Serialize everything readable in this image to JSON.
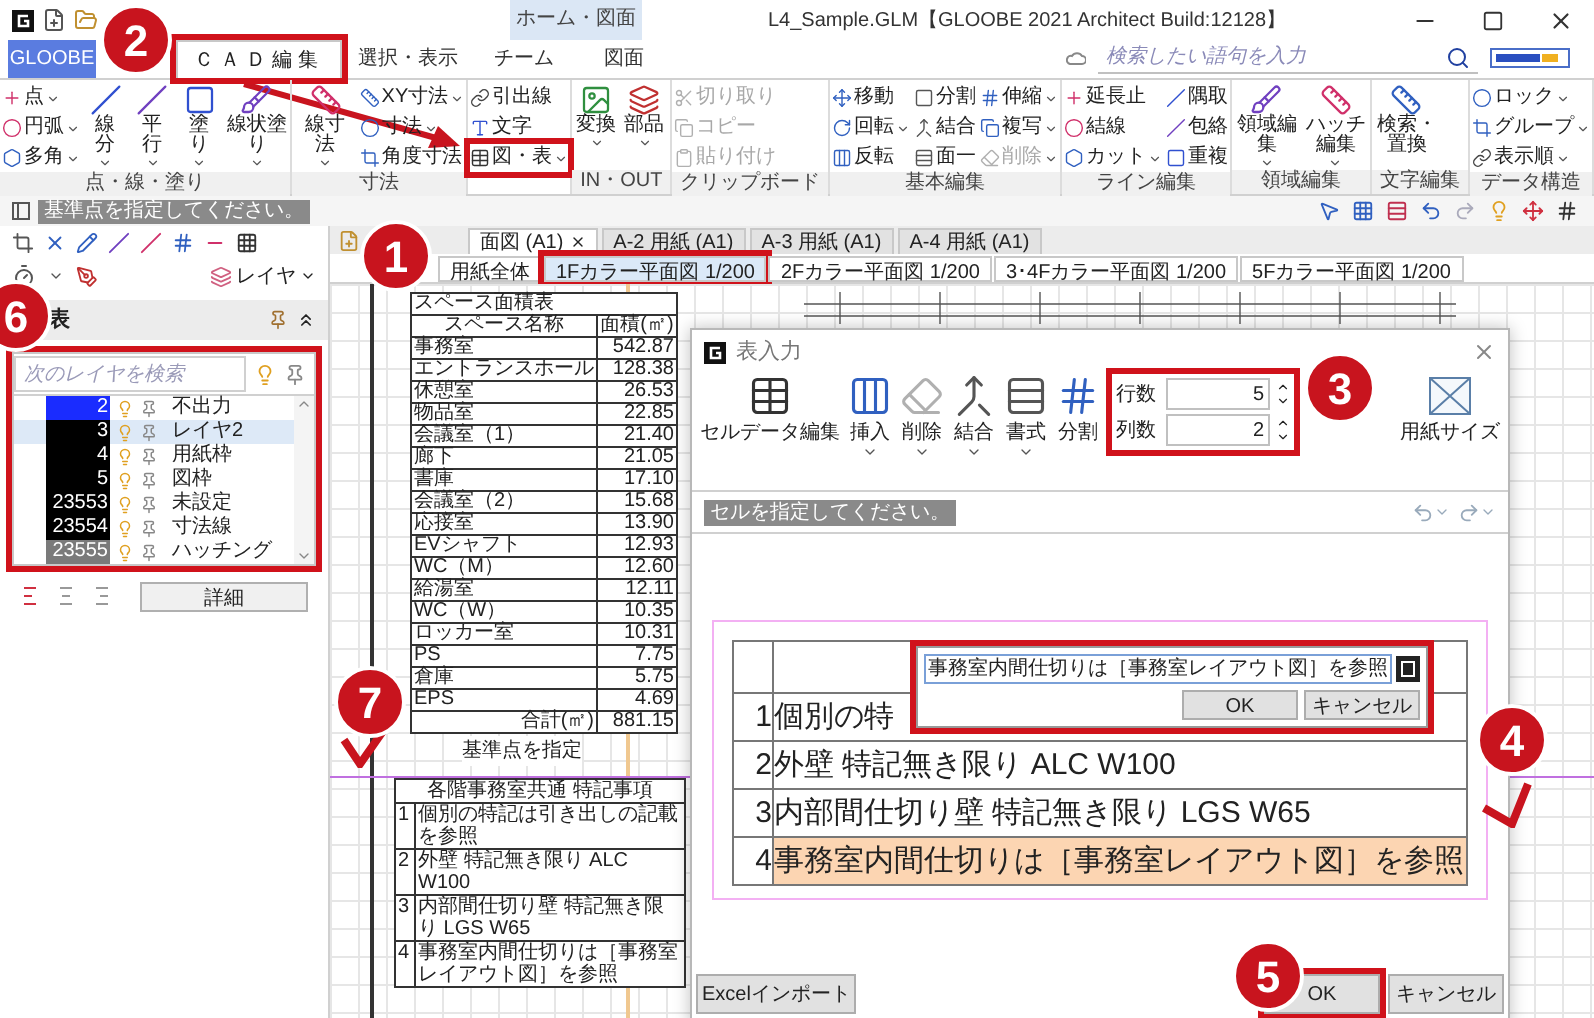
{
  "title_bar": {
    "title": "L4_Sample.GLM【GLOOBE 2021 Architect Build:12128】",
    "context_label": "ホーム・図面"
  },
  "ribbon": {
    "tabs": [
      {
        "label": "GLOOBE",
        "kind": "app",
        "selected": false,
        "highlighted": false
      },
      {
        "label": "ＣＡＤ編集",
        "kind": "tab",
        "selected": true,
        "highlighted": true
      },
      {
        "label": "選択・表示",
        "kind": "tab",
        "selected": false,
        "highlighted": false
      },
      {
        "label": "チーム",
        "kind": "tab",
        "selected": false,
        "highlighted": false
      },
      {
        "label": "図面",
        "kind": "tab",
        "selected": false,
        "highlighted": false
      }
    ],
    "search": {
      "placeholder": "検索したい語句を入力"
    },
    "groups": [
      {
        "label": "点・線・塗り",
        "items": [
          {
            "kind": "small",
            "label": "点",
            "dropdown": true
          },
          {
            "kind": "small",
            "label": "円弧",
            "dropdown": true
          },
          {
            "kind": "small",
            "label": "多角",
            "dropdown": true
          },
          {
            "kind": "large",
            "label": "線分",
            "dropdown": true
          },
          {
            "kind": "large",
            "label": "平行",
            "dropdown": true
          },
          {
            "kind": "large",
            "label": "塗り",
            "dropdown": true
          },
          {
            "kind": "large",
            "label": "線状塗り",
            "dropdown": true
          }
        ]
      },
      {
        "label": "寸法",
        "items": [
          {
            "kind": "large",
            "label": "線寸法",
            "dropdown": true
          },
          {
            "kind": "small",
            "label": "XY寸法",
            "dropdown": true
          },
          {
            "kind": "small",
            "label": "寸法",
            "dropdown": true
          },
          {
            "kind": "small",
            "label": "角度寸法",
            "dropdown": false
          }
        ]
      },
      {
        "items": [
          {
            "kind": "small",
            "label": "引出線",
            "dropdown": false,
            "highlighted": false
          },
          {
            "kind": "small",
            "label": "文字",
            "dropdown": false,
            "highlighted": false
          },
          {
            "kind": "small",
            "label": "図・表",
            "dropdown": true,
            "highlighted": true
          }
        ]
      },
      {
        "label": "IN・OUT",
        "items": [
          {
            "kind": "large",
            "label": "変換",
            "dropdown": true
          },
          {
            "kind": "large",
            "label": "部品",
            "dropdown": true
          }
        ]
      },
      {
        "label": "クリップボード",
        "items": [
          {
            "kind": "small",
            "label": "切り取り",
            "dropdown": false,
            "disabled": true
          },
          {
            "kind": "small",
            "label": "コピー",
            "dropdown": false,
            "disabled": true
          },
          {
            "kind": "small",
            "label": "貼り付け",
            "dropdown": false,
            "disabled": true
          }
        ]
      },
      {
        "label": "基本編集",
        "items": [
          {
            "kind": "small",
            "label": "移動",
            "dropdown": false,
            "disabled": false
          },
          {
            "kind": "small",
            "label": "回転",
            "dropdown": true,
            "disabled": false
          },
          {
            "kind": "small",
            "label": "反転",
            "dropdown": false,
            "disabled": false
          },
          {
            "kind": "small",
            "label": "分割",
            "dropdown": false,
            "disabled": false
          },
          {
            "kind": "small",
            "label": "結合",
            "dropdown": false,
            "disabled": false
          },
          {
            "kind": "small",
            "label": "面一",
            "dropdown": false,
            "disabled": false
          },
          {
            "kind": "small",
            "label": "伸縮",
            "dropdown": true,
            "disabled": false
          },
          {
            "kind": "small",
            "label": "複写",
            "dropdown": true,
            "disabled": false
          },
          {
            "kind": "small",
            "label": "削除",
            "dropdown": true,
            "disabled": true
          }
        ]
      },
      {
        "label": "ライン編集",
        "items": [
          {
            "kind": "small",
            "label": "延長止",
            "dropdown": false
          },
          {
            "kind": "small",
            "label": "結線",
            "dropdown": false
          },
          {
            "kind": "small",
            "label": "カット",
            "dropdown": true
          },
          {
            "kind": "small",
            "label": "隅取",
            "dropdown": false
          },
          {
            "kind": "small",
            "label": "包絡",
            "dropdown": false
          },
          {
            "kind": "small",
            "label": "重複",
            "dropdown": false
          }
        ]
      },
      {
        "label": "領域編集",
        "items": [
          {
            "kind": "large",
            "label": "領域編集",
            "dropdown": true
          },
          {
            "kind": "large",
            "label": "ハッチ編集",
            "dropdown": true
          }
        ]
      },
      {
        "label": "文字編集",
        "items": [
          {
            "kind": "large",
            "label": "検索・置換",
            "dropdown": false
          }
        ]
      },
      {
        "label": "データ構造",
        "items": [
          {
            "kind": "small",
            "label": "ロック",
            "dropdown": true
          },
          {
            "kind": "small",
            "label": "グループ",
            "dropdown": true
          },
          {
            "kind": "small",
            "label": "表示順",
            "dropdown": true
          }
        ]
      }
    ]
  },
  "status": "基準点を指定してください。",
  "left_panel": {
    "layer_button": "レイヤ",
    "title": "表",
    "highlighted": true,
    "search": {
      "placeholder": "次のレイヤを検索"
    },
    "layers": [
      {
        "number": "2",
        "name": "不出力",
        "color": "#1a2cff",
        "selected": false
      },
      {
        "number": "3",
        "name": "レイヤ2",
        "color": "#000000",
        "selected": true
      },
      {
        "number": "4",
        "name": "用紙枠",
        "color": "#000000",
        "selected": false
      },
      {
        "number": "5",
        "name": "図枠",
        "color": "#000000",
        "selected": false
      },
      {
        "number": "23553",
        "name": "未設定",
        "color": "#000000",
        "selected": false
      },
      {
        "number": "23554",
        "name": "寸法線",
        "color": "#000000",
        "selected": false
      },
      {
        "number": "23555",
        "name": "ハッチング",
        "color": "#7a7a7a",
        "selected": false
      }
    ],
    "detail_button": "詳細"
  },
  "doc_tabs": [
    {
      "label": "面図 (A1)",
      "selected": true,
      "closable": true
    },
    {
      "label": "A-2 用紙 (A1)",
      "selected": false,
      "closable": false
    },
    {
      "label": "A-3 用紙 (A1)",
      "selected": false,
      "closable": false
    },
    {
      "label": "A-4 用紙 (A1)",
      "selected": false,
      "closable": false
    }
  ],
  "view_tabs": [
    {
      "label": "用紙全体",
      "selected": false,
      "highlighted": false
    },
    {
      "label": "1Fカラー平面図 1/200",
      "selected": true,
      "highlighted": true
    },
    {
      "label": "2Fカラー平面図 1/200",
      "selected": false,
      "highlighted": false
    },
    {
      "label": "3･4Fカラー平面図 1/200",
      "selected": false,
      "highlighted": false
    },
    {
      "label": "5Fカラー平面図 1/200",
      "selected": false,
      "highlighted": false
    }
  ],
  "canvas": {
    "area_table": {
      "title": "スペース面積表",
      "columns": [
        "スペース名称",
        "面積(㎡)"
      ],
      "rows": [
        {
          "name": "事務室",
          "area": "542.87"
        },
        {
          "name": "エントランスホール",
          "area": "128.38"
        },
        {
          "name": "休憩室",
          "area": "26.53"
        },
        {
          "name": "物品室",
          "area": "22.85"
        },
        {
          "name": "会議室（1）",
          "area": "21.40"
        },
        {
          "name": "廊下",
          "area": "21.05"
        },
        {
          "name": "書庫",
          "area": "17.10"
        },
        {
          "name": "会議室（2）",
          "area": "15.68"
        },
        {
          "name": "応接室",
          "area": "13.90"
        },
        {
          "name": "EVシャフト",
          "area": "12.93"
        },
        {
          "name": "WC（M）",
          "area": "12.60"
        },
        {
          "name": "給湯室",
          "area": "12.11"
        },
        {
          "name": "WC（W）",
          "area": "10.35"
        },
        {
          "name": "ロッカー室",
          "area": "10.31"
        },
        {
          "name": "PS",
          "area": "7.75"
        },
        {
          "name": "倉庫",
          "area": "5.75"
        },
        {
          "name": "EPS",
          "area": "4.69"
        }
      ],
      "total": {
        "label": "合計(㎡)",
        "value": "881.15"
      }
    },
    "base_point_label": "基準点を指定",
    "note_table": {
      "header": "各階事務室共通 特記事項",
      "rows": [
        {
          "number": "1",
          "text": "個別の特記は引き出しの記載を参照"
        },
        {
          "number": "2",
          "text": "外壁 特記無き限り ALC W100"
        },
        {
          "number": "3",
          "text": "内部間仕切り壁 特記無き限り LGS W65"
        },
        {
          "number": "4",
          "text": "事務室内間仕切りは［事務室レイアウト図］を参照"
        }
      ]
    }
  },
  "table_dialog": {
    "title": "表入力",
    "tools": [
      {
        "label": "セルデータ編集",
        "dropdown": false
      },
      {
        "label": "挿入",
        "dropdown": true
      },
      {
        "label": "削除",
        "dropdown": true
      },
      {
        "label": "結合",
        "dropdown": true
      },
      {
        "label": "書式",
        "dropdown": true
      },
      {
        "label": "分割",
        "dropdown": false
      }
    ],
    "size_fields": {
      "highlighted": true,
      "fields": [
        {
          "label": "行数",
          "value": "5"
        },
        {
          "label": "列数",
          "value": "2"
        }
      ]
    },
    "paper_size": "用紙サイズ",
    "status": "セルを指定してください。",
    "preview_rows": [
      {
        "number": "1",
        "text": "個別の特",
        "selected": false
      },
      {
        "number": "2",
        "text": "外壁 特記無き限り ALC W100",
        "selected": false
      },
      {
        "number": "3",
        "text": "内部間仕切り壁 特記無き限り LGS W65",
        "selected": false
      },
      {
        "number": "4",
        "text": "事務室内間仕切りは［事務室レイアウト図］を参照",
        "selected": true
      }
    ],
    "cell_editor": {
      "value": "事務室内間仕切りは［事務室レイアウト図］を参照",
      "highlighted": true,
      "buttons": [
        "OK",
        "キャンセル"
      ]
    },
    "import_button": "Excelインポート",
    "buttons": [
      {
        "label": "OK",
        "highlighted": true
      },
      {
        "label": "キャンセル",
        "highlighted": false
      }
    ]
  },
  "callouts": [
    {
      "number": "1"
    },
    {
      "number": "2"
    },
    {
      "number": "3"
    },
    {
      "number": "4"
    },
    {
      "number": "5"
    },
    {
      "number": "6"
    },
    {
      "number": "7"
    }
  ]
}
